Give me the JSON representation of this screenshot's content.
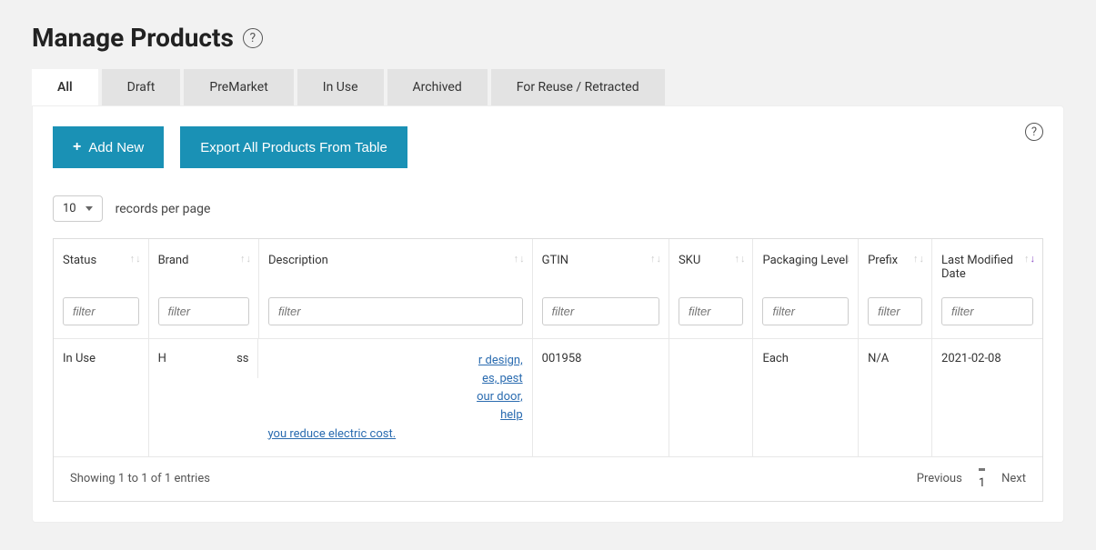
{
  "title": "Manage Products",
  "tabs": [
    "All",
    "Draft",
    "PreMarket",
    "In Use",
    "Archived",
    "For Reuse / Retracted"
  ],
  "active_tab_index": 0,
  "buttons": {
    "add_new": "Add New",
    "export_all": "Export All Products From Table"
  },
  "records": {
    "select_value": "10",
    "label": "records per page"
  },
  "columns": [
    {
      "key": "status",
      "label": "Status"
    },
    {
      "key": "brand",
      "label": "Brand"
    },
    {
      "key": "description",
      "label": "Description"
    },
    {
      "key": "gtin",
      "label": "GTIN"
    },
    {
      "key": "sku",
      "label": "SKU"
    },
    {
      "key": "packaging",
      "label": "Packaging Level"
    },
    {
      "key": "prefix",
      "label": "Prefix"
    },
    {
      "key": "modified",
      "label": "Last Modified Date"
    }
  ],
  "filter_placeholder": "filter",
  "rows": [
    {
      "status": "In Use",
      "brand_left": "H",
      "brand_right": "ss",
      "description_lines": [
        {
          "plain": "",
          "link": "r design,"
        },
        {
          "plain": "",
          "link": "es, pest"
        },
        {
          "plain": "",
          "link": "our door,"
        },
        {
          "plain": "",
          "link": " help"
        },
        {
          "plain": "",
          "link": "you reduce electric cost."
        }
      ],
      "gtin": "001958",
      "sku": "",
      "packaging": "Each",
      "prefix": "N/A",
      "modified": "2021-02-08"
    }
  ],
  "footer": {
    "entries_text": "Showing 1 to 1 of 1 entries",
    "previous": "Previous",
    "page": "1",
    "next": "Next"
  }
}
